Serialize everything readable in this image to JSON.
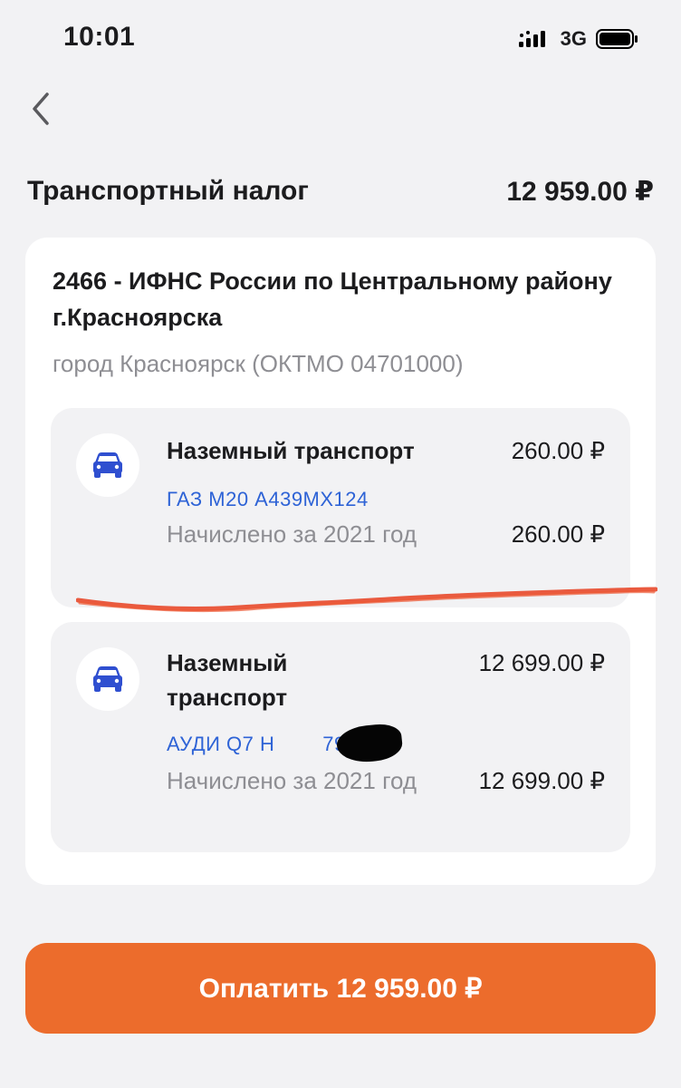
{
  "status_bar": {
    "time": "10:01",
    "network": "3G",
    "icons": [
      "signal-icon",
      "battery-icon"
    ]
  },
  "nav": {
    "back_icon": "chevron-left-icon"
  },
  "header": {
    "title": "Транспортный налог",
    "total": "12 959.00 ₽"
  },
  "tax_office": {
    "name": "2466 - ИФНС России по Центральному району г.Красноярска",
    "location": "город Красноярск (ОКТМО 04701000)"
  },
  "items": [
    {
      "icon": "car-icon",
      "title": "Наземный транспорт",
      "amount": "260.00 ₽",
      "vehicle": "ГАЗ М20 А439МХ124",
      "accrued_label": "Начислено за 2021 год",
      "accrued_amount": "260.00 ₽"
    },
    {
      "icon": "car-icon",
      "title": "Наземный транспорт",
      "amount": "12 699.00 ₽",
      "vehicle": "АУДИ Q7 Н        799",
      "accrued_label": "Начислено за 2021 год",
      "accrued_amount": "12 699.00 ₽"
    }
  ],
  "pay_button": {
    "label": "Оплатить 12 959.00 ₽"
  },
  "colors": {
    "accent": "#ec6c2c",
    "link": "#2e63d6",
    "car_icon": "#2f4fd0",
    "annotation": "#e8492b",
    "secondary_text": "#8e8e93",
    "background": "#f2f2f4"
  }
}
